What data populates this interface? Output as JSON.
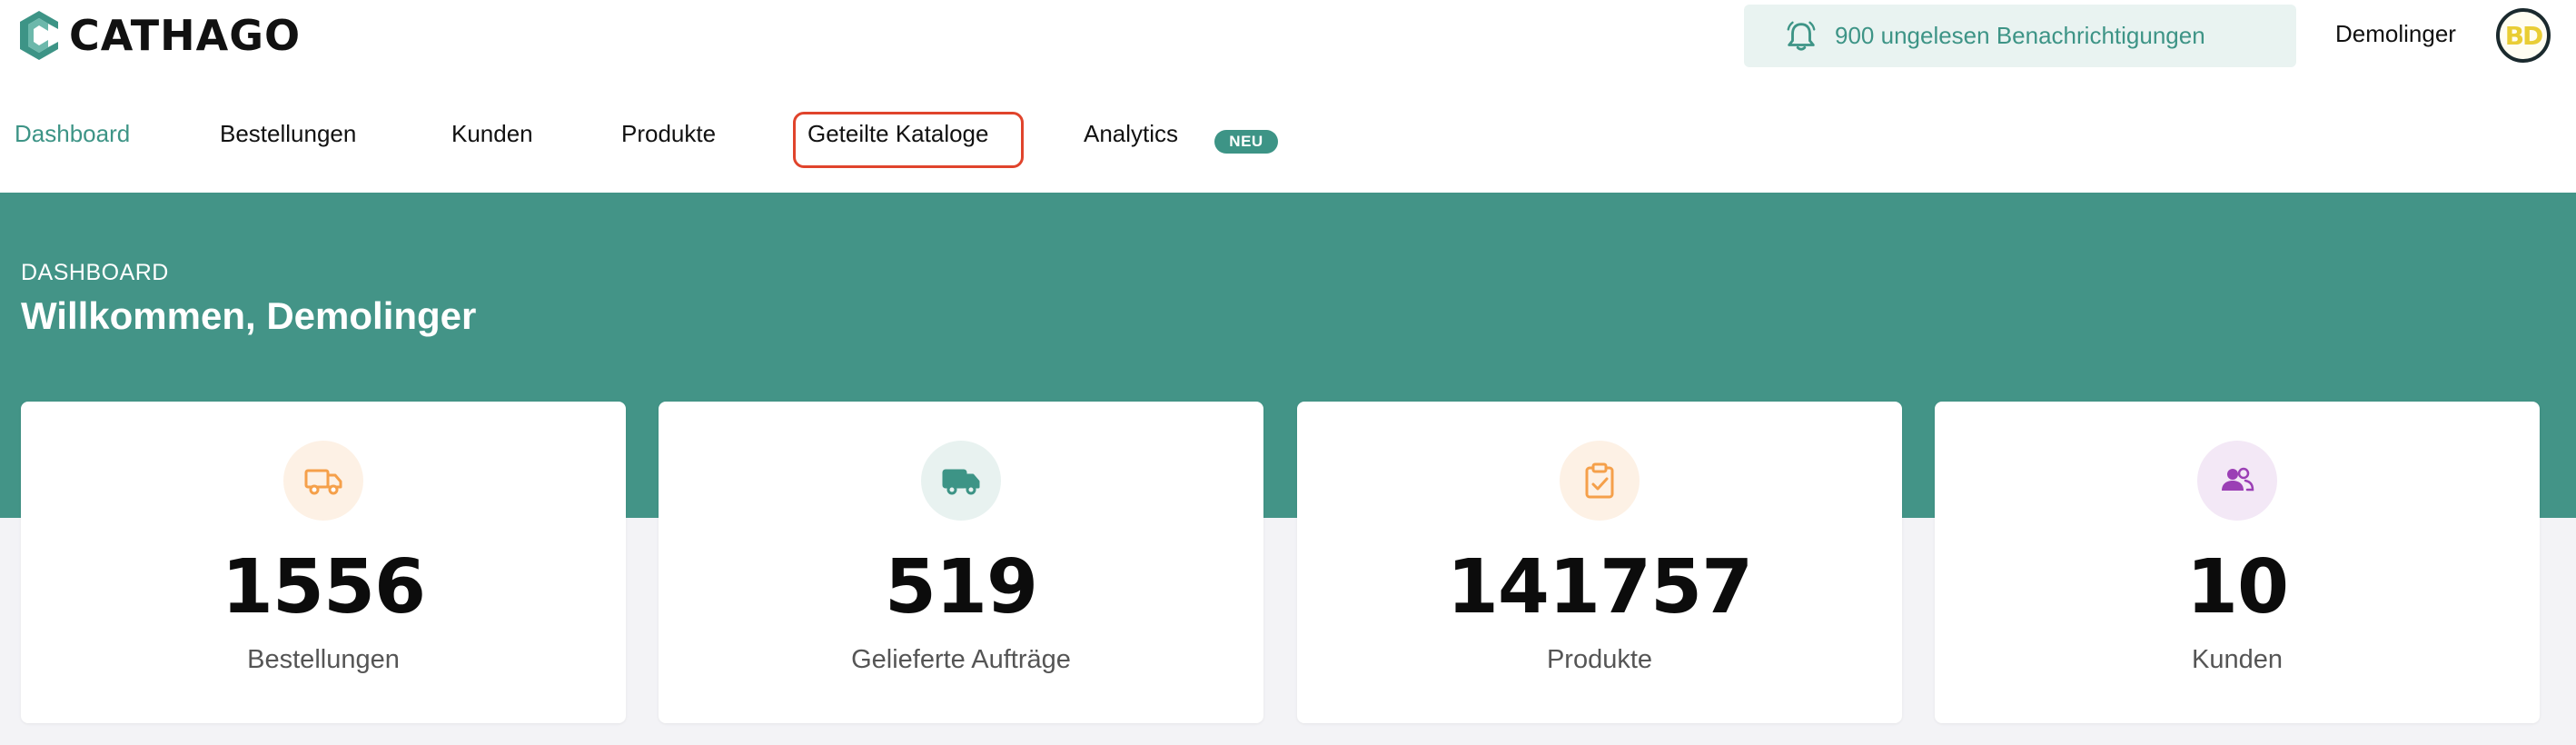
{
  "brand": {
    "name": "CATHAGO",
    "color": "#3d9486"
  },
  "header": {
    "notifications_label": "900 ungelesen Benachrichtigungen",
    "username": "Demolinger",
    "avatar_initials": "BD"
  },
  "nav": {
    "items": [
      {
        "label": "Dashboard",
        "active": true
      },
      {
        "label": "Bestellungen"
      },
      {
        "label": "Kunden"
      },
      {
        "label": "Produkte"
      },
      {
        "label": "Geteilte Kataloge",
        "highlighted": true
      },
      {
        "label": "Analytics"
      }
    ],
    "analytics_badge": "NEU"
  },
  "hero": {
    "kicker": "DASHBOARD",
    "title": "Willkommen, Demolinger"
  },
  "stats": [
    {
      "value": "1556",
      "label": "Bestellungen",
      "icon": "truck-icon",
      "icon_color": "#f5a04a",
      "icon_bg": "#fdf1e5"
    },
    {
      "value": "519",
      "label": "Gelieferte Aufträge",
      "icon": "truck-icon",
      "icon_color": "#3d9486",
      "icon_bg": "#e8f2f0"
    },
    {
      "value": "141757",
      "label": "Produkte",
      "icon": "clipboard-check-icon",
      "icon_color": "#f5a04a",
      "icon_bg": "#fdf1e5"
    },
    {
      "value": "10",
      "label": "Kunden",
      "icon": "users-icon",
      "icon_color": "#9b3fb5",
      "icon_bg": "#f3e8f6"
    }
  ]
}
